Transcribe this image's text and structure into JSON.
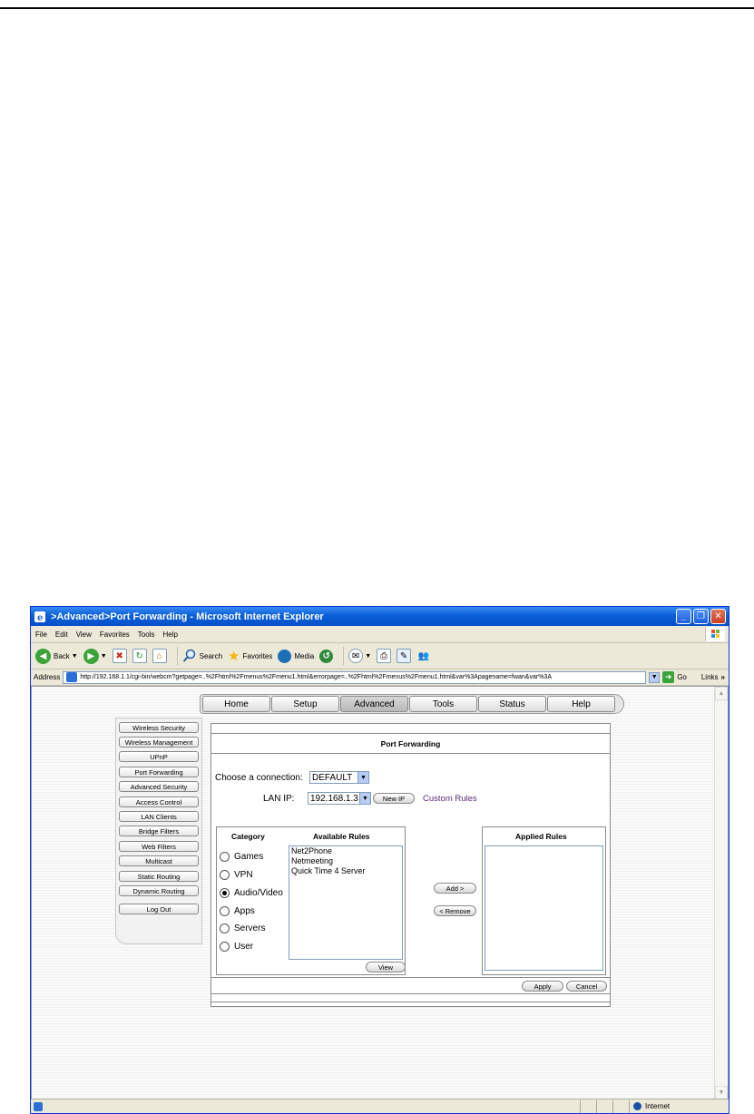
{
  "window": {
    "title": ">Advanced>Port Forwarding - Microsoft Internet Explorer",
    "btn_min": "_",
    "btn_max": "❐",
    "btn_close": "✕"
  },
  "menu": [
    "File",
    "Edit",
    "View",
    "Favorites",
    "Tools",
    "Help"
  ],
  "toolbar": {
    "back": "Back",
    "search": "Search",
    "favorites": "Favorites",
    "media": "Media"
  },
  "address": {
    "label": "Address",
    "url": "http://192.168.1.1/cgi-bin/webcm?getpage=..%2Fhtml%2Fmenus%2Fmenu1.html&errorpage=..%2Fhtml%2Fmenus%2Fmenu1.html&var%3Apagename=fwan&var%3A",
    "go": "Go",
    "links": "Links",
    "links_chevron": "»"
  },
  "nav": [
    "Home",
    "Setup",
    "Advanced",
    "Tools",
    "Status",
    "Help"
  ],
  "sidebar": [
    "Wireless Security",
    "Wireless Management",
    "UPnP",
    "Port Forwarding",
    "Advanced Security",
    "Access Control",
    "LAN Clients",
    "Bridge Filters",
    "Web Filters",
    "Multicast",
    "Static Routing",
    "Dynamic Routing",
    "Log Out"
  ],
  "page": {
    "title": "Port Forwarding",
    "connection_label": "Choose a connection:",
    "connection_value": "DEFAULT",
    "lanip_label": "LAN IP:",
    "lanip_value": "192.168.1.3",
    "new_ip": "New IP",
    "custom_rules": "Custom Rules",
    "category_head": "Category",
    "available_head": "Available Rules",
    "applied_head": "Applied Rules",
    "categories": [
      "Games",
      "VPN",
      "Audio/Video",
      "Apps",
      "Servers",
      "User"
    ],
    "selected_category": "Audio/Video",
    "available_rules": [
      "Net2Phone",
      "Netmeeting",
      "Quick Time 4 Server"
    ],
    "view": "View",
    "add": "Add >",
    "remove": "< Remove",
    "apply": "Apply",
    "cancel": "Cancel"
  },
  "status": {
    "zone": "Internet"
  },
  "colors": {
    "titlebar": "#0a5fd8",
    "custom_rules_link": "#5a2a7a"
  }
}
